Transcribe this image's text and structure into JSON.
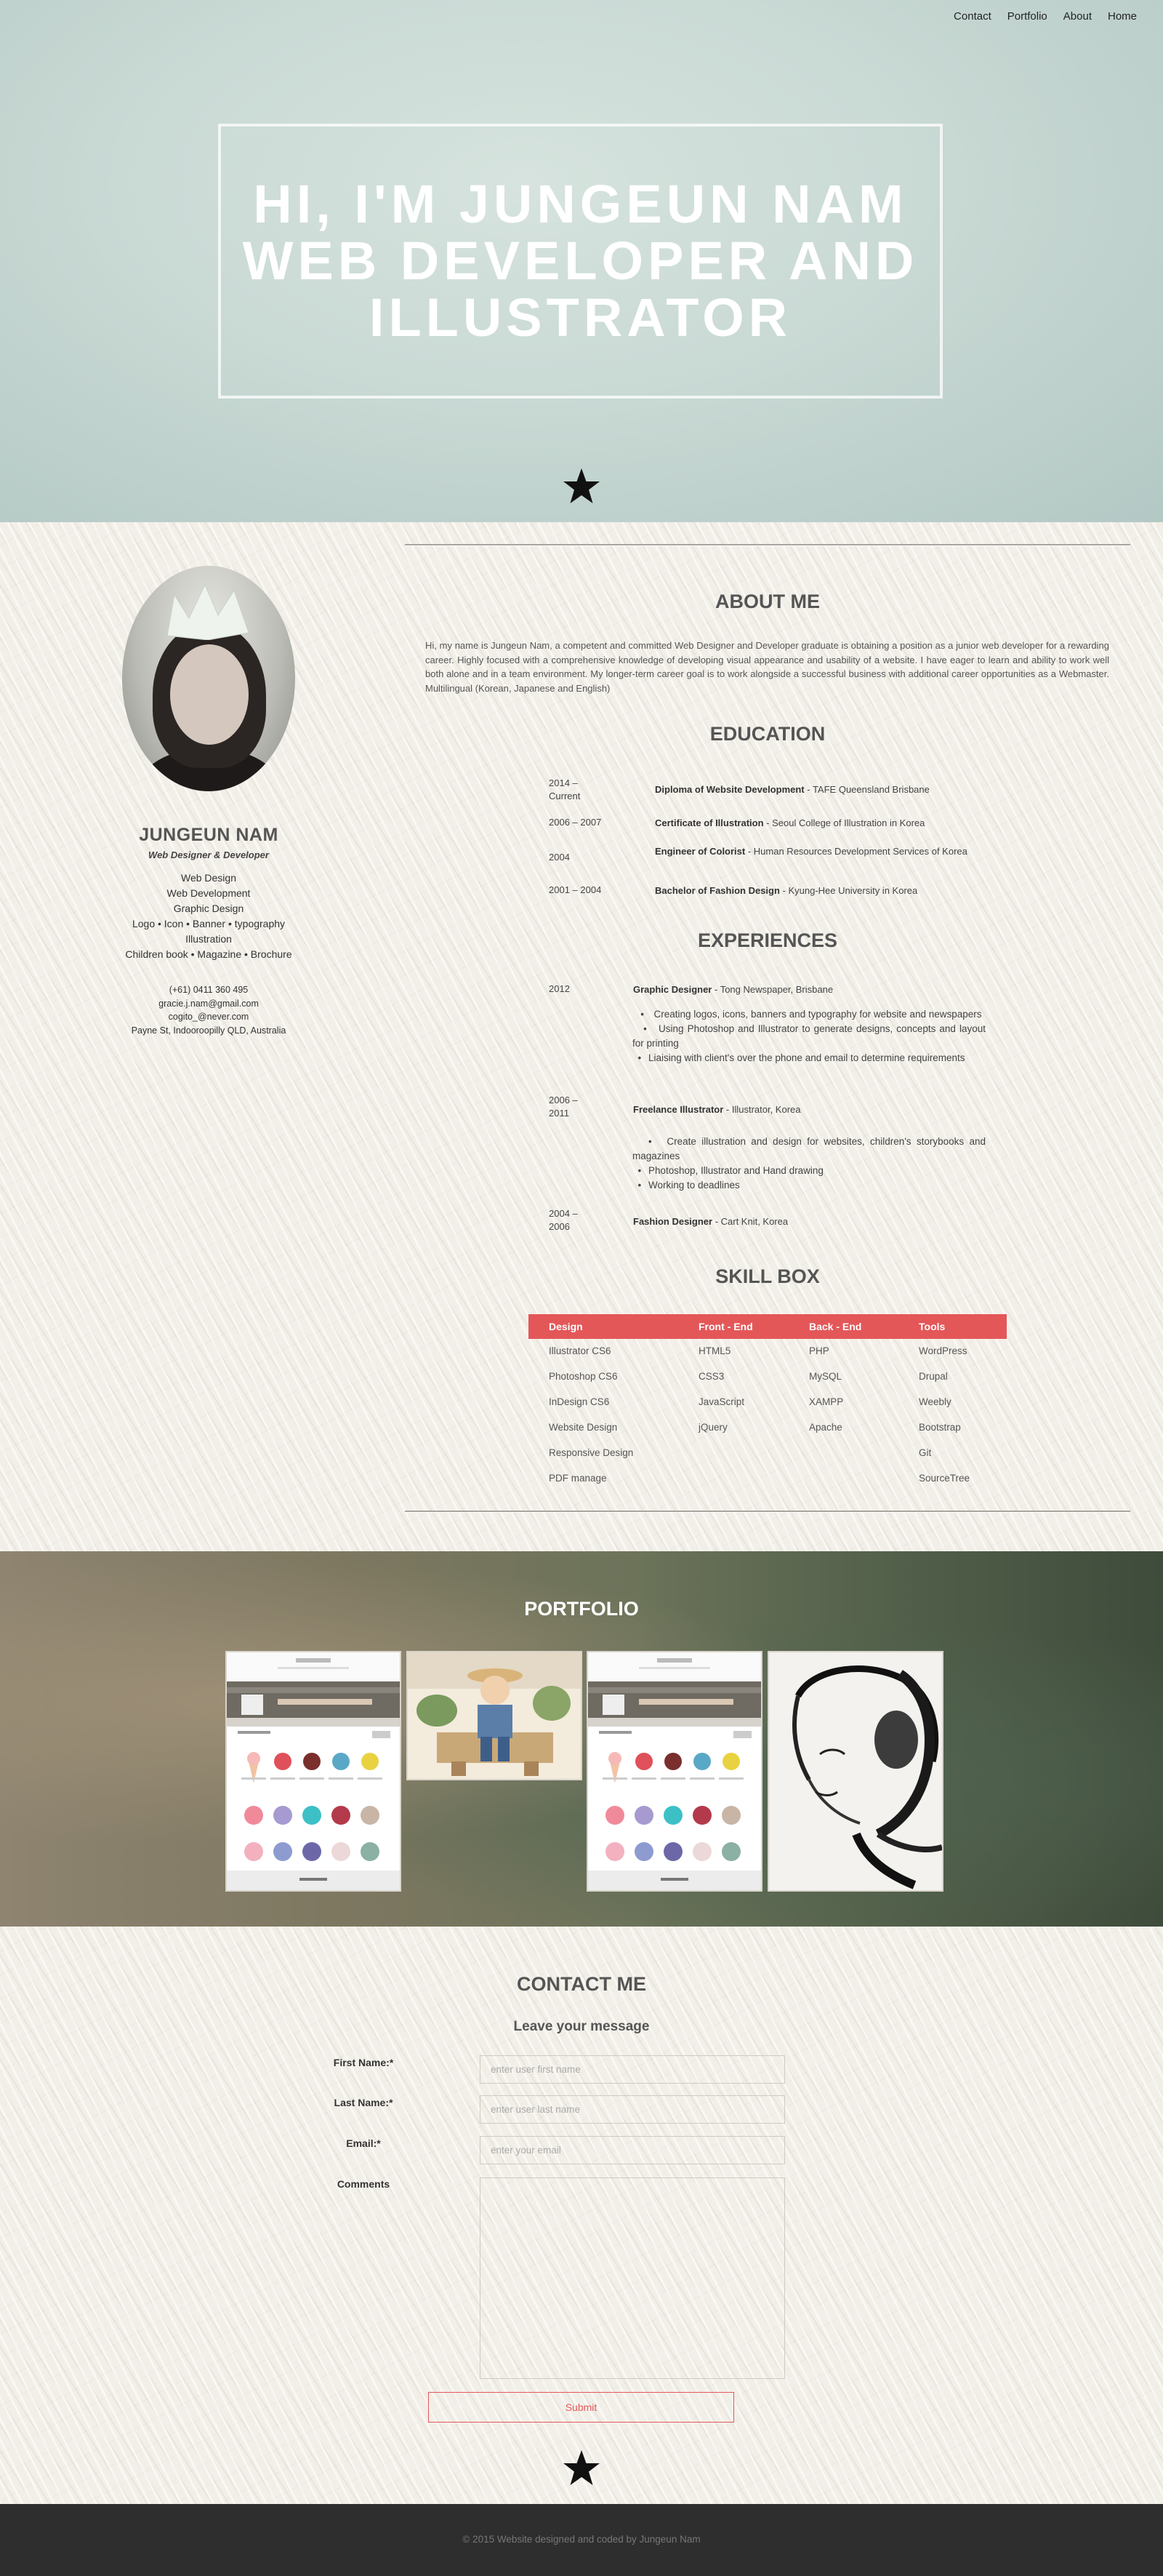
{
  "nav": [
    "Contact",
    "Portfolio",
    "About",
    "Home"
  ],
  "hero": {
    "line1": "HI, I'M JUNGEUN NAM",
    "line2": "WEB DEVELOPER AND",
    "line3": "ILLUSTRATOR"
  },
  "profile": {
    "name": "JUNGEUN NAM",
    "role": "Web Designer & Developer",
    "skills": [
      "Web Design",
      "Web Development",
      "Graphic Design",
      "Logo • Icon • Banner • typography",
      "Illustration",
      "Children book • Magazine • Brochure"
    ],
    "contact": [
      "(+61) 0411 360 495",
      "gracie.j.nam@gmail.com",
      "cogito_@never.com",
      "Payne St, Indooroopilly QLD, Australia"
    ]
  },
  "about": {
    "title": "ABOUT ME",
    "text": "Hi, my name is Jungeun Nam, a competent and committed Web Designer and Developer graduate is obtaining a position as a junior web developer for a rewarding career. Highly focused with a comprehensive knowledge of developing visual appearance and usability of a website. I have eager to learn and ability to work well both alone and in a team environment. My longer-term career goal is to work alongside a successful business with additional career opportunities as a Webmaster. Multilingual (Korean, Japanese and English)"
  },
  "education": {
    "title": "EDUCATION",
    "items": [
      {
        "year": "2014        –\nCurrent",
        "strong": "Diploma of Website Development",
        "rest": " - TAFE Queensland Brisbane"
      },
      {
        "year": "2006 – 2007",
        "strong": "Certificate of Illustration",
        "rest": " - Seoul College of Illustration in Korea"
      },
      {
        "year": "2004",
        "strong": "Engineer of Colorist",
        "rest": " - Human Resources Development Services of Korea"
      },
      {
        "year": "2001 – 2004",
        "strong": "Bachelor of Fashion Design",
        "rest": " - Kyung-Hee University in Korea"
      }
    ]
  },
  "experiences": {
    "title": "EXPERIENCES",
    "items": [
      {
        "year": "2012",
        "strong": "Graphic Designer",
        "rest": " - Tong Newspaper, Brisbane",
        "bullets": [
          "Creating logos, icons, banners and typography for website and newspapers",
          "Using Photoshop and Illustrator to generate designs, concepts and layout for printing",
          "Liaising with client's over the phone and email to determine requirements"
        ]
      },
      {
        "year": "2006    –\n2011",
        "strong": "Freelance Illustrator",
        "rest": " - Illustrator, Korea",
        "bullets": [
          "Create illustration and design for websites, children's storybooks and magazines",
          "Photoshop, Illustrator and Hand drawing",
          "Working to deadlines"
        ]
      },
      {
        "year": "2004    –\n2006",
        "strong": "Fashion Designer",
        "rest": " - Cart Knit, Korea",
        "bullets": []
      }
    ]
  },
  "skillbox": {
    "title": "SKILL BOX",
    "headers": [
      "Design",
      "Front - End",
      "Back - End",
      "Tools"
    ],
    "columns": [
      [
        "Illustrator CS6",
        "Photoshop CS6",
        "InDesign CS6",
        "Website Design",
        "Responsive Design",
        "PDF manage"
      ],
      [
        "HTML5",
        "CSS3",
        "JavaScript",
        "jQuery"
      ],
      [
        "PHP",
        "MySQL",
        "XAMPP",
        "Apache"
      ],
      [
        "WordPress",
        "Drupal",
        "Weebly",
        "Bootstrap",
        "Git",
        "SourceTree"
      ]
    ]
  },
  "portfolio": {
    "title": "PORTFOLIO"
  },
  "contact": {
    "title": "CONTACT ME",
    "subtitle": "Leave your message",
    "first_label": "First Name:*",
    "first_placeholder": "enter user first name",
    "last_label": "Last Name:*",
    "last_placeholder": "enter user last name",
    "email_label": "Email:*",
    "email_placeholder": "enter your email",
    "comments_label": "Comments",
    "submit": "Submit"
  },
  "footer": {
    "text": "© 2015 Website designed and coded by Jungeun Nam"
  },
  "colors": {
    "accent": "#e45759",
    "hero_bg": "#c9d9d4",
    "footer_bg": "#2e2e2e"
  }
}
